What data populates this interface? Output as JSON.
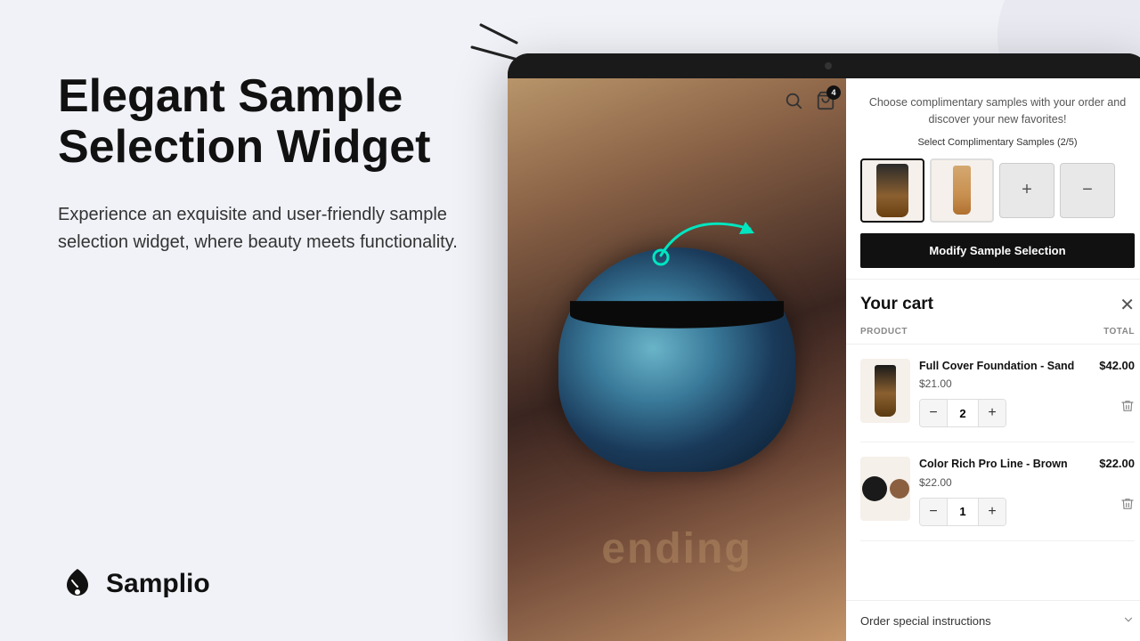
{
  "hero": {
    "title": "Elegant Sample Selection Widget",
    "description": "Experience an exquisite and user-friendly sample selection widget, where beauty meets functionality."
  },
  "logo": {
    "name": "Samplio"
  },
  "sample_widget": {
    "header_text": "Choose complimentary samples with your order and discover your new favorites!",
    "subtext": "Select Complimentary Samples (2/5)",
    "modify_btn_label": "Modify Sample Selection",
    "plus_symbol": "+",
    "minus_symbol": "−"
  },
  "cart": {
    "title": "Your cart",
    "close_symbol": "✕",
    "columns": {
      "product": "PRODUCT",
      "total": "TOTAL"
    },
    "items": [
      {
        "name": "Full Cover Foundation - Sand",
        "unit_price": "$21.00",
        "quantity": 2,
        "total": "$42.00"
      },
      {
        "name": "Color Rich Pro Line - Brown",
        "unit_price": "$22.00",
        "quantity": 1,
        "total": "$22.00"
      }
    ],
    "instructions_label": "Order special instructions"
  }
}
